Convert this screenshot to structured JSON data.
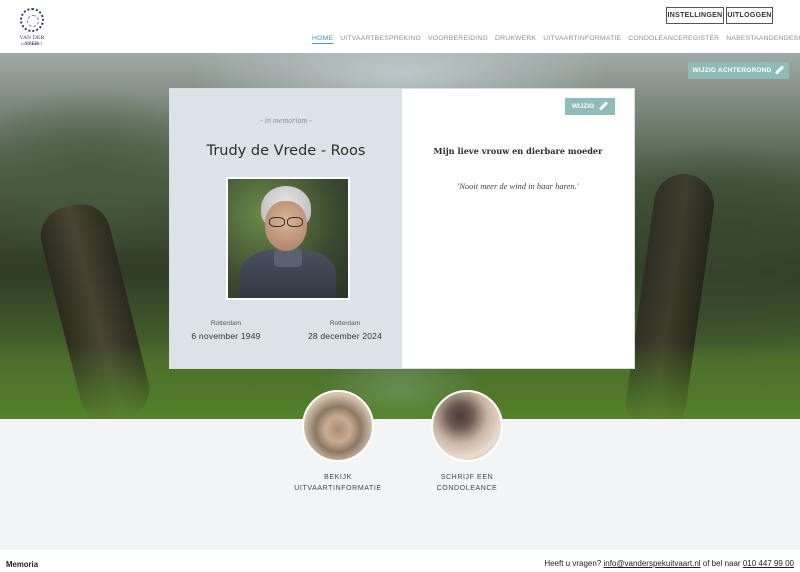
{
  "header": {
    "logo_name": "VAN DER SPEK",
    "logo_sub": "UITVAART",
    "settings_label": "INSTELLINGEN",
    "logout_label": "UITLOGGEN",
    "nav": [
      {
        "label": "HOME",
        "active": true
      },
      {
        "label": "UITVAARTBESPREKING",
        "active": false
      },
      {
        "label": "VOORBEREIDING",
        "active": false
      },
      {
        "label": "DRUKWERK",
        "active": false
      },
      {
        "label": "UITVAARTINFORMATIE",
        "active": false
      },
      {
        "label": "CONDOLEANCEREGISTER",
        "active": false
      },
      {
        "label": "NABESTAANDENDESK",
        "active": false
      }
    ]
  },
  "hero": {
    "change_background_label": "WIJZIG ACHTERGROND"
  },
  "memorial": {
    "in_memoriam": "- in memoriam -",
    "name": "Trudy de Vrede - Roos",
    "birth_place": "Rotterdam",
    "birth_date": "6 november 1949",
    "death_place": "Rotterdam",
    "death_date": "28 december 2024",
    "edit_label": "WIJZIG",
    "heading": "Mijn lieve vrouw en dierbare moeder",
    "quote": "'Nooit meer de wind in haar haren.'"
  },
  "actions": [
    {
      "line1": "BEKIJK",
      "line2": "UITVAARTINFORMATIE"
    },
    {
      "line1": "SCHRIJF EEN",
      "line2": "CONDOLEANCE"
    }
  ],
  "footer": {
    "brand": "Memoria",
    "help_prefix": "Heeft u vragen?",
    "email": "info@vanderspekuitvaart.nl",
    "help_middle": "of bel naar",
    "phone": "010 447 99 00"
  },
  "colors": {
    "accent_teal": "#8fbcb8",
    "nav_active": "#4d93c7",
    "card_left_bg": "#dce3e8"
  }
}
